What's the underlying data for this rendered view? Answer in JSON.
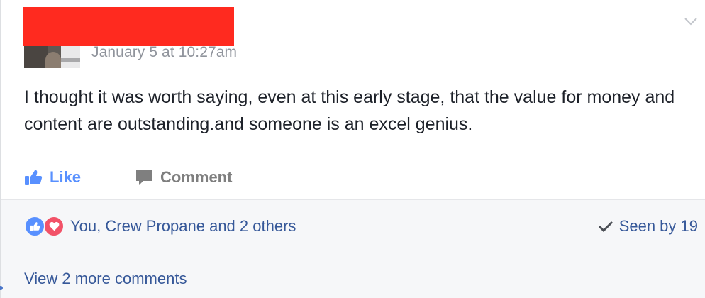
{
  "post": {
    "timestamp": "January 5 at 10:27am",
    "text": "I thought it was worth saying, even at this early stage, that the value for money and content are outstanding.and someone is an excel genius."
  },
  "actions": {
    "like_label": "Like",
    "comment_label": "Comment"
  },
  "feedback": {
    "reactions_text": "You, Crew Propane and 2 others",
    "seen_text": "Seen by 19",
    "more_comments_text": "View 2 more comments"
  },
  "icons": {
    "chevron": "chevron-down-icon",
    "like": "thumbs-up-icon",
    "comment": "comment-bubble-icon",
    "like_reaction": "like-reaction-icon",
    "love_reaction": "love-reaction-icon",
    "seen": "checkmark-icon"
  },
  "colors": {
    "redaction": "#ff2a1f",
    "link": "#365899",
    "like_blue": "#5890ff",
    "love_red": "#f25268",
    "muted_text": "#90949c",
    "body_text": "#1d2129"
  }
}
